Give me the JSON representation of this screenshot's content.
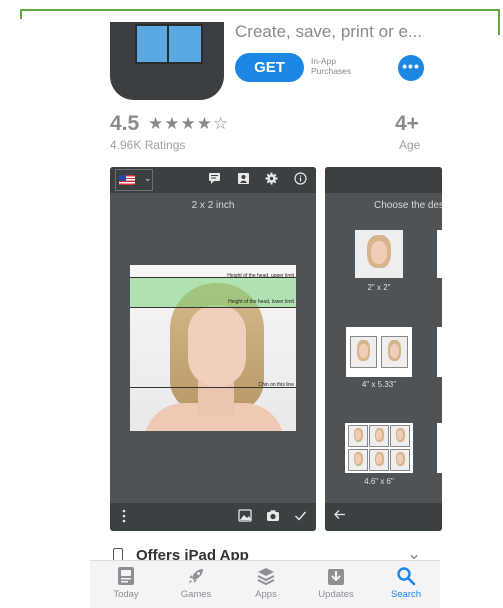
{
  "header": {
    "subtitle": "Create, save, print or e...",
    "get_label": "GET",
    "in_app_line1": "In-App",
    "in_app_line2": "Purchases",
    "more_label": "•••"
  },
  "stats": {
    "rating": "4.5",
    "stars": "★★★★☆",
    "ratings_count": "4.96K Ratings",
    "age": "4+",
    "age_label": "Age"
  },
  "screenshot1": {
    "size_label": "2 x 2 inch",
    "caret": "⌄",
    "marker_upper": "Height of the head, upper limit",
    "marker_lower": "Height of the head, lower limit",
    "marker_chin": "Chin on this line",
    "icons": [
      "message-icon",
      "portrait-icon",
      "gear-icon",
      "info-icon"
    ],
    "bottom_icons": [
      "menu-dots-icon",
      "gallery-icon",
      "camera-icon",
      "check-icon"
    ]
  },
  "screenshot2": {
    "heading": "Choose the desi",
    "formats": [
      {
        "label": "2\" x 2\""
      },
      {
        "label": "4\" x 5.33\""
      },
      {
        "label": "4.6\" x 6\""
      }
    ]
  },
  "ipad": {
    "label": "Offers iPad App",
    "chevron": "⌄"
  },
  "tabs": [
    {
      "label": "Today",
      "icon": "today-icon",
      "glyph": "▤",
      "active": false
    },
    {
      "label": "Games",
      "icon": "rocket-icon",
      "glyph": "🚀",
      "active": false
    },
    {
      "label": "Apps",
      "icon": "layers-icon",
      "glyph": "≋",
      "active": false
    },
    {
      "label": "Updates",
      "icon": "download-icon",
      "glyph": "⇩",
      "active": false
    },
    {
      "label": "Search",
      "icon": "search-icon",
      "glyph": "⚲",
      "active": true
    }
  ],
  "colors": {
    "accent": "#1d86e5",
    "frame_green": "#5fa83a",
    "screenshot_bg": "#4d5356"
  }
}
